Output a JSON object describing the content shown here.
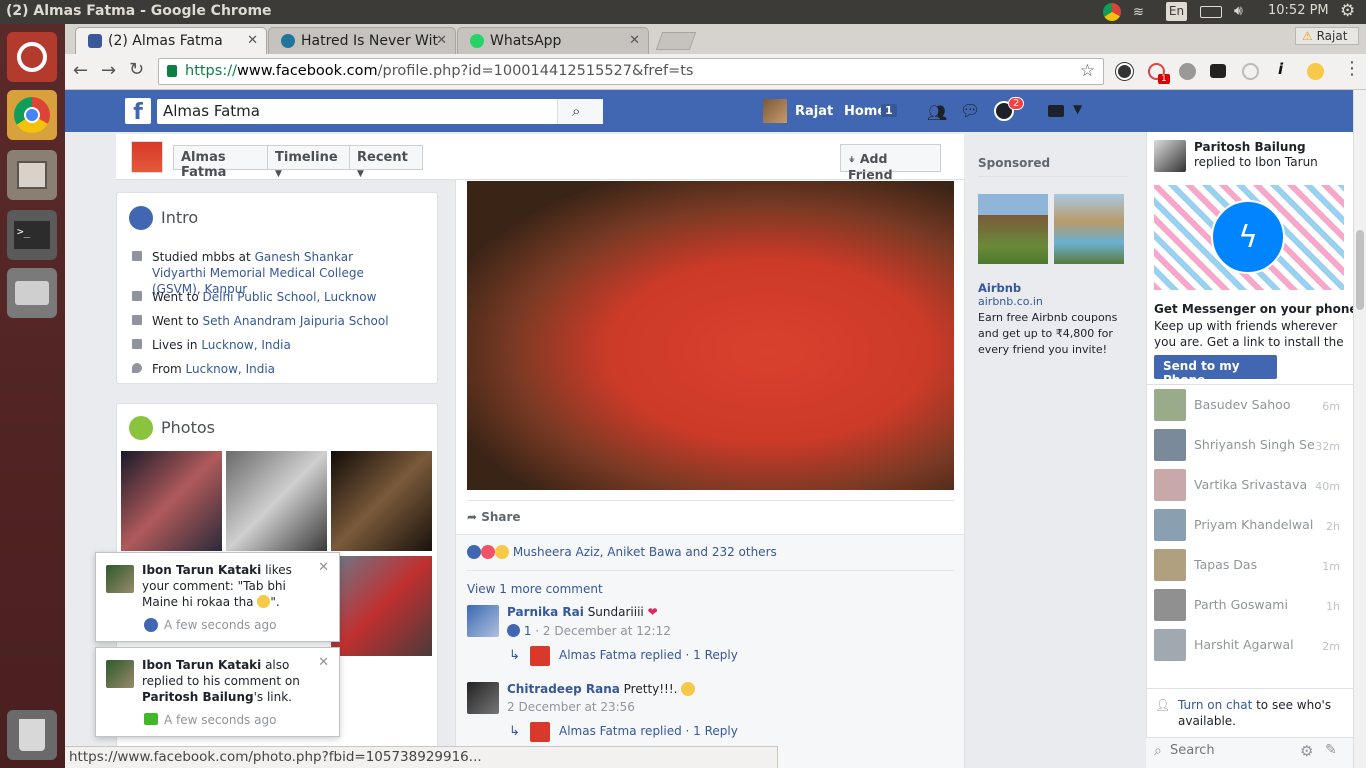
{
  "os": {
    "window_title": "(2) Almas Fatma - Google Chrome",
    "lang": "En",
    "clock": "10:52 PM"
  },
  "browser": {
    "tabs": [
      {
        "label": "(2) Almas Fatma",
        "active": true
      },
      {
        "label": "Hatred Is Never Wit",
        "active": false
      },
      {
        "label": "WhatsApp",
        "active": false
      }
    ],
    "profile_label": "Rajat",
    "url_scheme": "https://",
    "url_host": "www.facebook.com",
    "url_path": "/profile.php?id=100014412515527&fref=ts",
    "status_url": "https://www.facebook.com/photo.php?fbid=105738929916...",
    "ext_badge": "1"
  },
  "fb": {
    "search_value": "Almas Fatma",
    "user_name": "Rajat",
    "home_label": "Home",
    "home_count": "1",
    "notif_count": "2"
  },
  "profile": {
    "name_btn": "Almas Fatma",
    "timeline_btn": "Timeline",
    "recent_btn": "Recent",
    "add_friend": "Add Friend"
  },
  "intro": {
    "title": "Intro",
    "rows": [
      {
        "prefix": "Studied mbbs at ",
        "link": "Ganesh Shankar Vidyarthi Memorial Medical College (GSVM), Kanpur"
      },
      {
        "prefix": "Went to ",
        "link": "Delhi Public School, Lucknow"
      },
      {
        "prefix": "Went to ",
        "link": "Seth Anandram Jaipuria School"
      },
      {
        "prefix": "Lives in ",
        "link": "Lucknow, India"
      },
      {
        "prefix": "From ",
        "link": "Lucknow, India"
      }
    ]
  },
  "photos": {
    "title": "Photos"
  },
  "notifications": [
    {
      "name": "Ibon Tarun Kataki",
      "text_a": " likes your comment: \"Tab bhi Maine hi rokaa tha ",
      "text_b": "\".",
      "time": "A few seconds ago"
    },
    {
      "name": "Ibon Tarun Kataki",
      "text_a": " also replied to his comment on ",
      "bold2": "Paritosh Bailung",
      "text_b": "'s link.",
      "time": "A few seconds ago"
    }
  ],
  "post": {
    "share_label": "Share",
    "reactions_text": "Musheera Aziz, Aniket Bawa and 232 others",
    "view_more": "View 1 more comment",
    "comments": [
      {
        "author": "Parnika Rai",
        "text": "Sundariiii",
        "likes": "1",
        "meta": "· 2 December at 12:12",
        "reply_author": "Almas Fatma",
        "reply_text": "replied · ",
        "reply_link": "1 Reply"
      },
      {
        "author": "Chitradeep Rana",
        "text": "Pretty!!!.",
        "meta": "2 December at 23:56",
        "reply_author": "Almas Fatma",
        "reply_text": "replied · ",
        "reply_link": "1 Reply"
      }
    ]
  },
  "sponsored": {
    "title": "Sponsored",
    "ad_name": "Airbnb",
    "ad_domain": "airbnb.co.in",
    "ad_text": "Earn free Airbnb coupons and get up to ₹4,800 for every friend you invite!"
  },
  "ticker": {
    "actor": "Paritosh Bailung",
    "text": " replied to Ibon Tarun Kataki's"
  },
  "messenger_promo": {
    "title": "Get Messenger on your phone",
    "text": "Keep up with friends wherever you are. Get a link to install the app.",
    "button": "Send to my Phone"
  },
  "chat": {
    "contacts": [
      {
        "name": "Basudev Sahoo",
        "time": "6m"
      },
      {
        "name": "Shriyansh Singh Se...",
        "time": "32m"
      },
      {
        "name": "Vartika Srivastava",
        "time": "40m"
      },
      {
        "name": "Priyam Khandelwal",
        "time": "2h"
      },
      {
        "name": "Tapas Das",
        "time": "1m"
      },
      {
        "name": "Parth Goswami",
        "time": "1h"
      },
      {
        "name": "Harshit Agarwal",
        "time": "2m"
      }
    ],
    "turn_on_link": "Turn on chat",
    "turn_on_text": " to see who's available.",
    "search_placeholder": "Search"
  }
}
